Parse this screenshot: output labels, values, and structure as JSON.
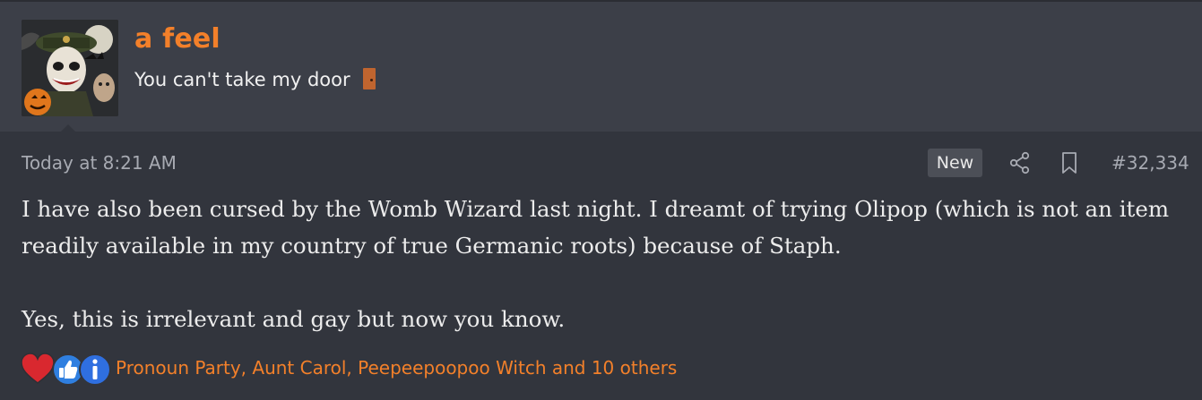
{
  "user": {
    "name": "a feel",
    "title": "You can't take my door",
    "avatar_icon": "avatar-image",
    "title_icon": "door-icon"
  },
  "post": {
    "timestamp": "Today at 8:21 AM",
    "new_badge": "New",
    "number": "#32,334",
    "paragraphs": [
      "I have also been cursed by the Womb Wizard last night. I dreamt of trying Olipop (which is not an item readily available in my country of true Germanic roots) because of Staph.",
      "Yes, this is irrelevant and gay but now you know."
    ]
  },
  "reactions": {
    "icons": [
      "heart-icon",
      "thumbs-up-icon",
      "info-icon"
    ],
    "summary": "Pronoun Party, Aunt Carol, Peepeepoopoo Witch and 10 others"
  },
  "colors": {
    "accent": "#f3802a",
    "background": "#32353d",
    "header_background": "#3c3f48",
    "text": "#ececec",
    "muted": "#a7aab2"
  }
}
